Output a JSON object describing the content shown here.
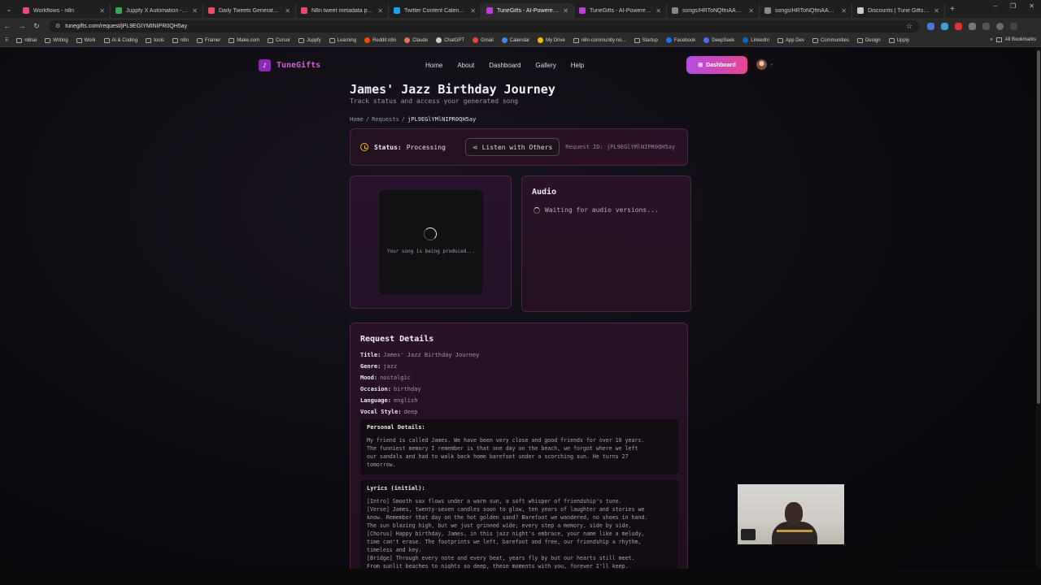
{
  "browser": {
    "tabs": [
      {
        "title": "Workflows - n8n",
        "color": "#ea4b71",
        "active": false
      },
      {
        "title": "Juppfy X Automation - Google",
        "color": "#34a853",
        "active": false
      },
      {
        "title": "Daily Tweets Generator - n8",
        "color": "#ea4b71",
        "active": false
      },
      {
        "title": "N8n tweet metadata processi",
        "color": "#ea4b71",
        "active": false
      },
      {
        "title": "Twitter Content Calendar Sy",
        "color": "#1da1f2",
        "active": false
      },
      {
        "title": "TuneGifts - AI-Powered Perso",
        "color": "#c13cd8",
        "active": true
      },
      {
        "title": "TuneGifts - AI-Powered Perso",
        "color": "#c13cd8",
        "active": false
      },
      {
        "title": "songs/HRToNQftnAAdw/anTi",
        "color": "#888888",
        "active": false
      },
      {
        "title": "songs/HRToNQftnAAdw/anTi",
        "color": "#888888",
        "active": false
      },
      {
        "title": "Discounts | Tune Gifts | Polar",
        "color": "#cccccc",
        "active": false
      }
    ],
    "url": "tunegifts.com/request/jPL9EGIYMINIPR0QH5ay",
    "bookmarks": [
      {
        "label": "n8nai",
        "kind": "folder"
      },
      {
        "label": "Writing",
        "kind": "folder"
      },
      {
        "label": "Work",
        "kind": "folder"
      },
      {
        "label": "Ai & Coding",
        "kind": "folder"
      },
      {
        "label": "tools",
        "kind": "folder"
      },
      {
        "label": "n8n",
        "kind": "folder"
      },
      {
        "label": "Framer",
        "kind": "folder"
      },
      {
        "label": "Make.com",
        "kind": "folder"
      },
      {
        "label": "Cursor",
        "kind": "folder"
      },
      {
        "label": "Juppfy",
        "kind": "folder"
      },
      {
        "label": "Learning",
        "kind": "folder"
      },
      {
        "label": "Reddit n8n",
        "kind": "site",
        "color": "#ff4500"
      },
      {
        "label": "Claude",
        "kind": "site",
        "color": "#d97757"
      },
      {
        "label": "ChatGPT",
        "kind": "site",
        "color": "#cccccc"
      },
      {
        "label": "Gmail",
        "kind": "site",
        "color": "#ea4335"
      },
      {
        "label": "Calendar",
        "kind": "site",
        "color": "#4285f4"
      },
      {
        "label": "My Drive",
        "kind": "site",
        "color": "#fbbc04"
      },
      {
        "label": "n8n-community-no...",
        "kind": "folder"
      },
      {
        "label": "Startup",
        "kind": "folder"
      },
      {
        "label": "Facebook",
        "kind": "site",
        "color": "#1877f2"
      },
      {
        "label": "DeepSeek",
        "kind": "site",
        "color": "#4d6bfe"
      },
      {
        "label": "LinkedIn",
        "kind": "site",
        "color": "#0a66c2"
      },
      {
        "label": "App Dev",
        "kind": "folder"
      },
      {
        "label": "Communities",
        "kind": "folder"
      },
      {
        "label": "Design",
        "kind": "folder"
      },
      {
        "label": "Upply",
        "kind": "folder"
      }
    ],
    "all_bookmarks": "All Bookmarks"
  },
  "site": {
    "logo_text": "TuneGifts",
    "logo_icon": "music-note-icon",
    "nav": [
      "Home",
      "About",
      "Dashboard",
      "Gallery",
      "Help"
    ],
    "dashboard_button": "Dashboard",
    "accent": "#c13cd8"
  },
  "page": {
    "title": "James' Jazz Birthday Journey",
    "subtitle": "Track status and access your generated song",
    "breadcrumb": [
      "Home",
      "Requests",
      "jPL9EGlYMlNIPR0QH5ay"
    ],
    "status_label": "Status:",
    "status_value": "Processing",
    "listen_button": "Listen with Others",
    "request_id": "Request ID: jPL9EGlYMlNIPR0QH5ay",
    "player_text": "Your song is being produced...",
    "audio_title": "Audio",
    "audio_waiting": "Waiting for audio versions...",
    "details_title": "Request Details",
    "details": [
      {
        "key": "Title:",
        "value": "James' Jazz Birthday Journey"
      },
      {
        "key": "Genre:",
        "value": "jazz"
      },
      {
        "key": "Mood:",
        "value": "nostalgic"
      },
      {
        "key": "Occasion:",
        "value": "birthday"
      },
      {
        "key": "Language:",
        "value": "english"
      },
      {
        "key": "Vocal Style:",
        "value": "deep"
      }
    ],
    "personal_title": "Personal Details:",
    "personal_text": "My friend is called James. We have been very close and good friends for over 10 years.\nThe funniest memory I remember is that one day on the beach, we forgot where we left\nour sandals and had to walk back home barefoot under a scorching sun. He turns 27\ntomorrow.",
    "lyrics_title": "Lyrics (initial):",
    "lyrics_text": "[Intro] Smooth sax flows under a warm sun, a soft whisper of friendship's tune.\n[Verse] James, twenty-seven candles soon to glow, ten years of laughter and stories we\nknow. Remember that day on the hot golden sand? Barefoot we wandered, no shoes in hand.\nThe sun blazing high, but we just grinned wide; every step a memory, side by side.\n[Chorus] Happy birthday, James, in this jazz night's embrace, your name like a melody,\ntime can't erase. The footprints we left, barefoot and free, our friendship a rhythm,\ntimeless and key.\n[Bridge] Through every note and every beat, years fly by but our hearts still meet.\nFrom sunlit beaches to nights so deep, these moments with you, forever I'll keep."
  }
}
